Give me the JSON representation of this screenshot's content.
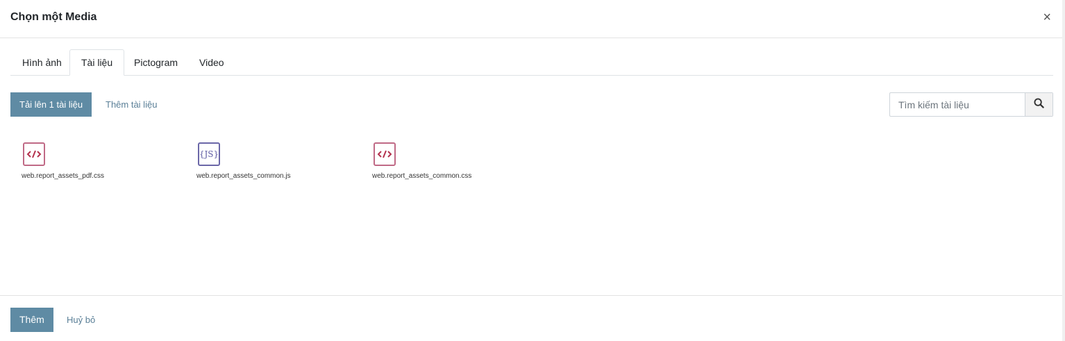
{
  "dialog": {
    "title": "Chọn một Media",
    "close_label": "×"
  },
  "tabs": [
    {
      "label": "Hình ảnh",
      "active": false
    },
    {
      "label": "Tài liệu",
      "active": true
    },
    {
      "label": "Pictogram",
      "active": false
    },
    {
      "label": "Video",
      "active": false
    }
  ],
  "toolbar": {
    "upload_label": "Tải lên 1 tài liệu",
    "add_document_label": "Thêm tài liệu"
  },
  "search": {
    "placeholder": "Tìm kiếm tài liệu",
    "value": "",
    "icon": "search-icon"
  },
  "files": [
    {
      "name": "web.report_assets_pdf.css",
      "type": "css",
      "icon": "code-file-icon"
    },
    {
      "name": "web.report_assets_common.js",
      "type": "js",
      "icon": "js-file-icon",
      "glyph": "{JS}"
    },
    {
      "name": "web.report_assets_common.css",
      "type": "css",
      "icon": "code-file-icon"
    }
  ],
  "footer": {
    "add_label": "Thêm",
    "cancel_label": "Huỷ bỏ"
  },
  "colors": {
    "primary": "#5f8ba4",
    "link": "#5a7f97",
    "css_icon": "#c06a86",
    "js_icon": "#6b67a8"
  }
}
